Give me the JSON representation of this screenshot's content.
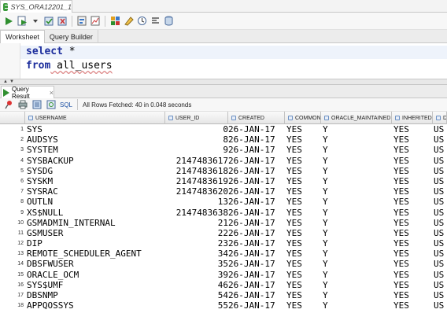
{
  "connection": {
    "tab_label": "SYS_ORA12201_1"
  },
  "toolbar": {
    "icons": [
      "run-statement-icon",
      "run-script-icon",
      "dropdown-icon",
      "commit-icon",
      "rollback-icon",
      "explain-plan-icon",
      "autotrace-icon",
      "sql-tuning-icon",
      "clear-icon",
      "history-icon",
      "format-icon",
      "db-icon"
    ]
  },
  "worksheet_tabs": [
    "Worksheet",
    "Query Builder"
  ],
  "editor": {
    "line1": {
      "keyword": "select",
      "rest": " *"
    },
    "line2": {
      "keyword": "from",
      "rest": " all_users"
    }
  },
  "result_tab": {
    "label": "Query Result",
    "close": "×"
  },
  "result_toolbar": {
    "sql_label": "SQL",
    "status": "All Rows Fetched: 40 in 0.048 seconds"
  },
  "grid": {
    "columns": [
      "USERNAME",
      "USER_ID",
      "CREATED",
      "COMMON",
      "ORACLE_MAINTAINED",
      "INHERITED",
      "D"
    ],
    "rows": [
      [
        "1",
        "SYS",
        "0",
        "26-JAN-17",
        "YES",
        "Y",
        "YES",
        "US"
      ],
      [
        "2",
        "AUDSYS",
        "8",
        "26-JAN-17",
        "YES",
        "Y",
        "YES",
        "US"
      ],
      [
        "3",
        "SYSTEM",
        "9",
        "26-JAN-17",
        "YES",
        "Y",
        "YES",
        "US"
      ],
      [
        "4",
        "SYSBACKUP",
        "2147483617",
        "26-JAN-17",
        "YES",
        "Y",
        "YES",
        "US"
      ],
      [
        "5",
        "SYSDG",
        "2147483618",
        "26-JAN-17",
        "YES",
        "Y",
        "YES",
        "US"
      ],
      [
        "6",
        "SYSKM",
        "2147483619",
        "26-JAN-17",
        "YES",
        "Y",
        "YES",
        "US"
      ],
      [
        "7",
        "SYSRAC",
        "2147483620",
        "26-JAN-17",
        "YES",
        "Y",
        "YES",
        "US"
      ],
      [
        "8",
        "OUTLN",
        "13",
        "26-JAN-17",
        "YES",
        "Y",
        "YES",
        "US"
      ],
      [
        "9",
        "XS$NULL",
        "2147483638",
        "26-JAN-17",
        "YES",
        "Y",
        "YES",
        "US"
      ],
      [
        "10",
        "GSMADMIN_INTERNAL",
        "21",
        "26-JAN-17",
        "YES",
        "Y",
        "YES",
        "US"
      ],
      [
        "11",
        "GSMUSER",
        "22",
        "26-JAN-17",
        "YES",
        "Y",
        "YES",
        "US"
      ],
      [
        "12",
        "DIP",
        "23",
        "26-JAN-17",
        "YES",
        "Y",
        "YES",
        "US"
      ],
      [
        "13",
        "REMOTE_SCHEDULER_AGENT",
        "34",
        "26-JAN-17",
        "YES",
        "Y",
        "YES",
        "US"
      ],
      [
        "14",
        "DBSFWUSER",
        "35",
        "26-JAN-17",
        "YES",
        "Y",
        "YES",
        "US"
      ],
      [
        "15",
        "ORACLE_OCM",
        "39",
        "26-JAN-17",
        "YES",
        "Y",
        "YES",
        "US"
      ],
      [
        "16",
        "SYS$UMF",
        "46",
        "26-JAN-17",
        "YES",
        "Y",
        "YES",
        "US"
      ],
      [
        "17",
        "DBSNMP",
        "54",
        "26-JAN-17",
        "YES",
        "Y",
        "YES",
        "US"
      ],
      [
        "18",
        "APPQOSSYS",
        "55",
        "26-JAN-17",
        "YES",
        "Y",
        "YES",
        "US"
      ]
    ]
  }
}
